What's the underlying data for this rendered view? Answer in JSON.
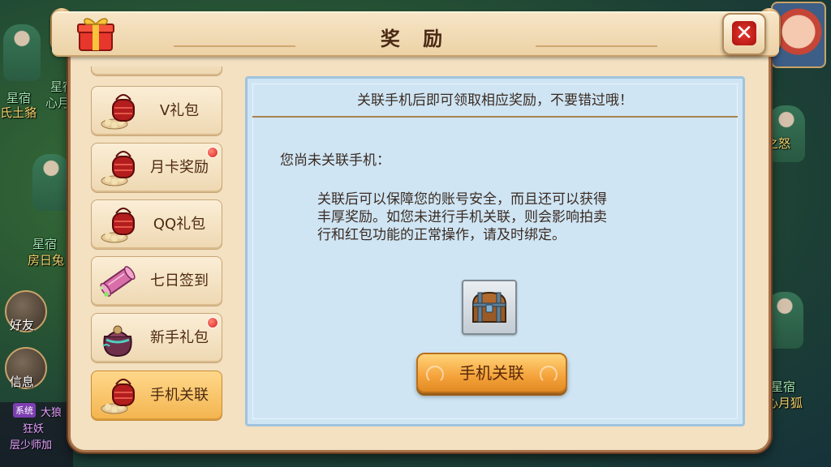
{
  "title": "奖 励",
  "tabs": [
    {
      "label": "V礼包",
      "icon": "red-lantern-icon",
      "badge": false,
      "active": false
    },
    {
      "label": "月卡奖励",
      "icon": "red-lantern-icon",
      "badge": true,
      "active": false
    },
    {
      "label": "QQ礼包",
      "icon": "red-lantern-icon",
      "badge": false,
      "active": false
    },
    {
      "label": "七日签到",
      "icon": "scroll-icon",
      "badge": false,
      "active": false
    },
    {
      "label": "新手礼包",
      "icon": "gift-bag-icon",
      "badge": true,
      "active": false
    },
    {
      "label": "手机关联",
      "icon": "red-lantern-icon",
      "badge": false,
      "active": true
    }
  ],
  "content": {
    "notice": "关联手机后即可领取相应奖励，不要错过哦！",
    "status": "您尚未关联手机：",
    "desc_line1": "关联后可以保障您的账号安全，而且还可以获得",
    "desc_line2": "丰厚奖励。如您未进行手机关联，则会影响拍卖",
    "desc_line3": "行和红包功能的正常操作，请及时绑定。",
    "reward_icon": "treasure-chest-icon",
    "button_label": "手机关联"
  },
  "background": {
    "side_buttons": [
      "好友",
      "信息"
    ],
    "names": [
      "星宿",
      "氏土貉",
      "星宿",
      "心月",
      "星宿",
      "房日兔",
      "星宿",
      "心月狐",
      "之怒"
    ],
    "chat_tag": "系统",
    "chat_lines": [
      "大狼",
      "狂妖",
      "层少师加"
    ]
  },
  "colors": {
    "panel_bg": "#f3e1c1",
    "content_bg": "#cfe5f4",
    "active_tab": "#f3b44f",
    "button": "#f5a23a",
    "badge": "#d8211a"
  }
}
